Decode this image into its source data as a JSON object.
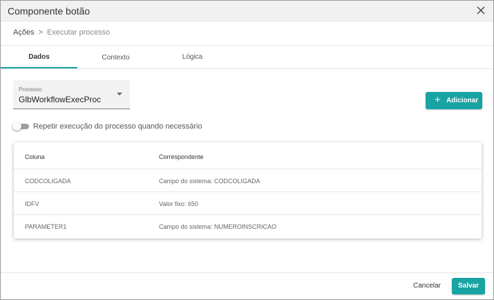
{
  "dialog": {
    "title": "Componente botão"
  },
  "breadcrumb": {
    "items": [
      "Ações",
      "Executar processo"
    ],
    "separator": ">"
  },
  "tabs": [
    {
      "label": "Dados",
      "active": true
    },
    {
      "label": "Contexto",
      "active": false
    },
    {
      "label": "Lógica",
      "active": false
    }
  ],
  "process_select": {
    "label": "Processo",
    "value": "GlbWorkflowExecProc"
  },
  "add_button": {
    "label": "Adicionar",
    "icon": "plus-icon"
  },
  "repeat_toggle": {
    "label": "Repetir execução do processo quando necessário",
    "checked": false
  },
  "mapping_table": {
    "columns": [
      "Coluna",
      "Correspondente"
    ],
    "rows": [
      {
        "coluna": "CODCOLIGADA",
        "correspondente": "Campo do sistema: CODCOLIGADA"
      },
      {
        "coluna": "IDFV",
        "correspondente": "Valor fixo: 650"
      },
      {
        "coluna": "PARAMETER1",
        "correspondente": "Campo do sistema: NUMEROINSCRICAO"
      }
    ]
  },
  "footer": {
    "cancel_label": "Cancelar",
    "save_label": "Salvar"
  },
  "colors": {
    "accent": "#1aa3a3",
    "titlebar": "#f1f1f1"
  }
}
